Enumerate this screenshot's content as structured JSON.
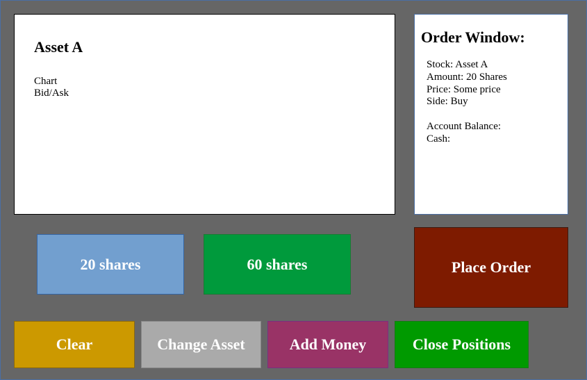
{
  "asset_panel": {
    "title": "Asset A",
    "lines": [
      "Chart",
      "Bid/Ask"
    ]
  },
  "order_window": {
    "title": "Order Window:",
    "stock": "Stock: Asset A",
    "amount": "Amount: 20 Shares",
    "price": "Price: Some price",
    "side": "Side: Buy",
    "account_balance": "Account Balance:",
    "cash": "Cash:"
  },
  "buttons": {
    "shares_20": "20 shares",
    "shares_60": "60 shares",
    "place_order": "Place Order",
    "clear": "Clear",
    "change_asset": "Change Asset",
    "add_money": "Add Money",
    "close_positions": "Close Positions"
  },
  "colors": {
    "background": "#666666",
    "shares_20": "#729fcf",
    "shares_60": "#009a3c",
    "place_order": "#7e1b00",
    "clear": "#cc9900",
    "change_asset": "#aaaaaa",
    "add_money": "#993366",
    "close_positions": "#009a00"
  }
}
